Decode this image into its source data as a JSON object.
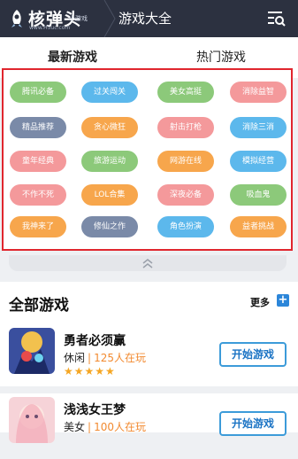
{
  "header": {
    "logo_text": "核弹头",
    "logo_sub": "小游戏",
    "logo_url": "www.H5uc.com",
    "title": "游戏大全",
    "menu_icon": "search-menu-icon"
  },
  "tabs": [
    {
      "label": "最新游戏",
      "active": true
    },
    {
      "label": "热门游戏",
      "active": false
    }
  ],
  "tags": [
    {
      "label": "腾讯必备",
      "color": "#8cc97a"
    },
    {
      "label": "过关闯关",
      "color": "#5cb8ec"
    },
    {
      "label": "美女高挺",
      "color": "#8cc97a"
    },
    {
      "label": "消除益智",
      "color": "#f4999b"
    },
    {
      "label": "精品推荐",
      "color": "#7a8aa8"
    },
    {
      "label": "贪心微狂",
      "color": "#f7a64c"
    },
    {
      "label": "射击打枪",
      "color": "#f4999b"
    },
    {
      "label": "消除三消",
      "color": "#5cb8ec"
    },
    {
      "label": "童年经典",
      "color": "#f4999b"
    },
    {
      "label": "旅游运动",
      "color": "#8cc97a"
    },
    {
      "label": "网游在线",
      "color": "#f7a64c"
    },
    {
      "label": "模拟经营",
      "color": "#5cb8ec"
    },
    {
      "label": "不作不死",
      "color": "#f4999b"
    },
    {
      "label": "LOL合集",
      "color": "#f7a64c"
    },
    {
      "label": "深夜必备",
      "color": "#f4999b"
    },
    {
      "label": "吸血鬼",
      "color": "#8cc97a"
    },
    {
      "label": "我神来了",
      "color": "#f7a64c"
    },
    {
      "label": "修仙之作",
      "color": "#7a8aa8"
    },
    {
      "label": "角色扮演",
      "color": "#5cb8ec"
    },
    {
      "label": "益者挑战",
      "color": "#f7a64c"
    }
  ],
  "all_games": {
    "title": "全部游戏",
    "more_label": "更多",
    "items": [
      {
        "name": "勇者必须赢",
        "category": "休闲",
        "players": "125人在玩",
        "stars": "★★★★★",
        "button": "开始游戏"
      },
      {
        "name": "浅浅女王梦",
        "category": "美女",
        "players": "100人在玩",
        "stars": "",
        "button": "开始游戏"
      }
    ]
  }
}
